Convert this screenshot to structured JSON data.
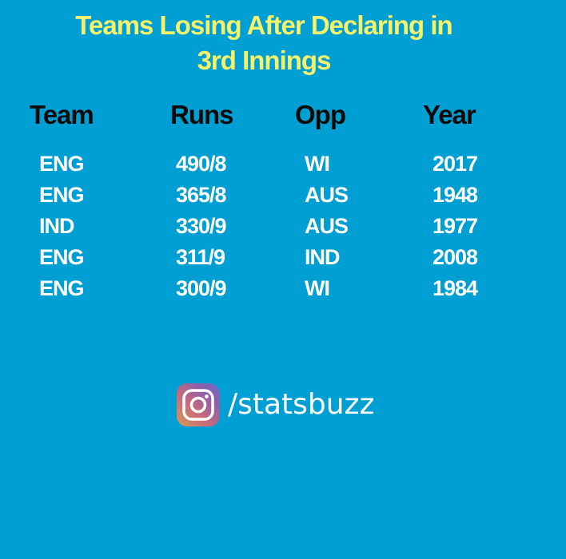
{
  "title": {
    "line1": "Teams Losing After Declaring in",
    "line2": "3rd Innings"
  },
  "table": {
    "headers": {
      "team": "Team",
      "runs": "Runs",
      "opp": "Opp",
      "year": "Year"
    },
    "rows": [
      {
        "team": "ENG",
        "runs": "490/8",
        "opp": "WI",
        "year": "2017"
      },
      {
        "team": "ENG",
        "runs": "365/8",
        "opp": "AUS",
        "year": "1948"
      },
      {
        "team": "IND",
        "runs": "330/9",
        "opp": "AUS",
        "year": "1977"
      },
      {
        "team": "ENG",
        "runs": "311/9",
        "opp": "IND",
        "year": "2008"
      },
      {
        "team": "ENG",
        "runs": "300/9",
        "opp": "WI",
        "year": "1984"
      }
    ]
  },
  "social": {
    "icon": "instagram-icon",
    "handle": "/statsbuzz"
  },
  "colors": {
    "background": "#009fd3",
    "title": "#f6f16a",
    "header": "#0a0a0a",
    "cell": "#ffffff"
  }
}
